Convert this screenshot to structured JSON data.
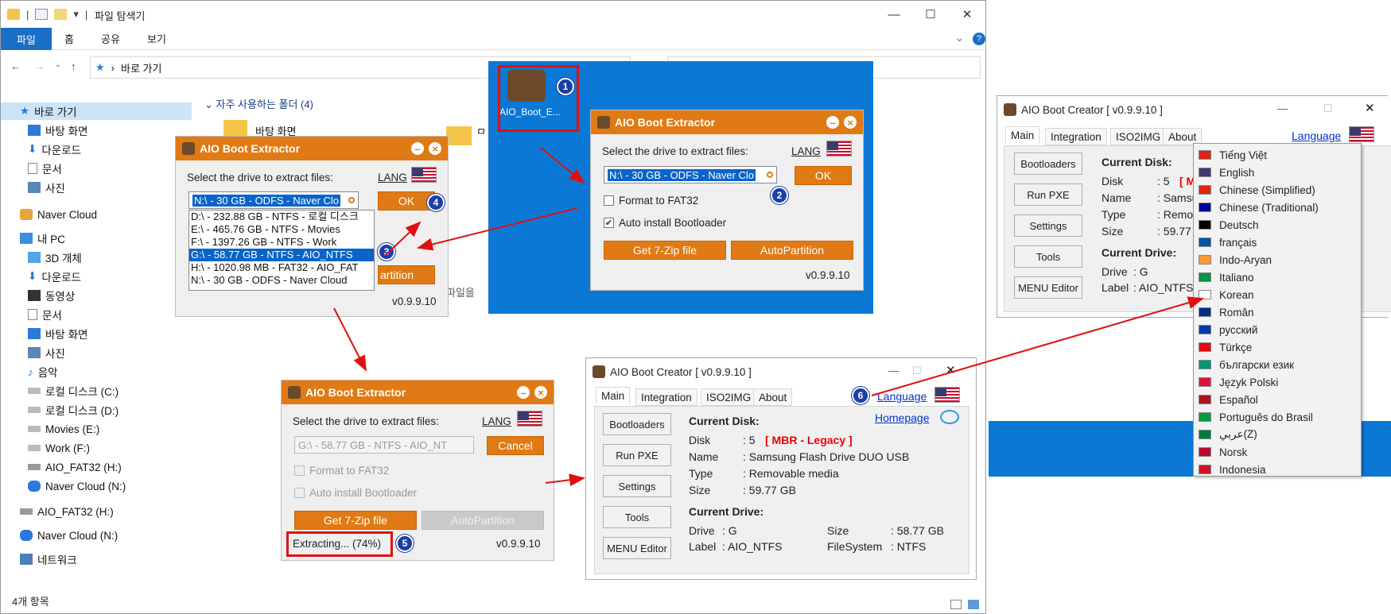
{
  "explorer": {
    "title": "파일 탐색기",
    "ribbon_tabs": [
      "파일",
      "홈",
      "공유",
      "보기"
    ],
    "address": "바로 가기",
    "frequent": "자주 사용하는 폴더 (4)",
    "folder_desktop": "바탕 화면",
    "partial_folder": "ㅁ",
    "partial_text": "파일을 ",
    "status": "4개 항목",
    "nav": [
      "바로 가기",
      "바탕 화면",
      "다운로드",
      "문서",
      "사진",
      "Naver Cloud",
      "내 PC",
      "3D 개체",
      "다운로드",
      "동영상",
      "문서",
      "바탕 화면",
      "사진",
      "음악",
      "로컬 디스크 (C:)",
      "로컬 디스크 (D:)",
      "Movies (E:)",
      "Work (F:)",
      "AIO_FAT32 (H:)",
      "Naver Cloud (N:)",
      "AIO_FAT32 (H:)",
      "Naver Cloud (N:)",
      "네트워크"
    ]
  },
  "desktop_icon": "AIO_Boot_E...",
  "extractor": {
    "title": "AIO Boot Extractor",
    "prompt": "Select the drive to extract files:",
    "lang": "LANG",
    "ok": "OK",
    "cancel": "Cancel",
    "format": "Format to FAT32",
    "auto": "Auto install Bootloader",
    "get7zip": "Get 7-Zip file",
    "autopart": "AutoPartition",
    "autopart_partial": "artition",
    "version": "v0.9.9.10",
    "drive_n": "N:\\ - 30 GB - ODFS - Naver Clo",
    "drive_n_main": "N:\\ - 30 GB - ODFS - Naver Clo",
    "drive_g": "G:\\ - 58.77 GB - NTFS - AIO_NT",
    "extracting": "Extracting... (74%)",
    "drives": [
      "D:\\ - 232.88 GB - NTFS - 로컬 디스크",
      "E:\\ - 465.76 GB - NTFS - Movies",
      "F:\\ - 1397.26 GB - NTFS - Work",
      "G:\\ - 58.77 GB - NTFS - AIO_NTFS",
      "H:\\ - 1020.98 MB - FAT32 - AIO_FAT",
      "N:\\ - 30 GB - ODFS - Naver Cloud"
    ]
  },
  "creator": {
    "title": "AIO Boot Creator [ v0.9.9.10 ]",
    "tabs": [
      "Main",
      "Integration",
      "ISO2IMG",
      "About"
    ],
    "language": "Language",
    "homepage": "Homepage",
    "buttons": [
      "Bootloaders",
      "Run PXE",
      "Settings",
      "Tools",
      "MENU Editor"
    ],
    "current_disk": "Current Disk:",
    "current_drive": "Current Drive:",
    "disk_label": "Disk",
    "disk_val": ": 5",
    "mbr": "[ MBR - Legacy ]",
    "mbr_short": "[ MBI",
    "name_label": "Name",
    "name_val": ": Samsung Flash Drive DUO USB",
    "name_short": ": Samsur",
    "type_label": "Type",
    "type_val": ": Removable media",
    "type_short": ": Remova",
    "size_label": "Size",
    "size_val": ": 59.77 GB",
    "size_short": ": 59.77 G",
    "drive_label": "Drive",
    "drive_val": ": G",
    "label_label": "Label",
    "label_val": ": AIO_NTFS",
    "dsize_label": "Size",
    "dsize_val": ": 58.77 GB",
    "fs_label": "FileSystem",
    "fs_val": ": NTFS"
  },
  "languages": [
    {
      "name": "Tiếng Việt",
      "color": "#da251d"
    },
    {
      "name": "English",
      "color": "#3c3b6e"
    },
    {
      "name": "Chinese (Simplified)",
      "color": "#de2910"
    },
    {
      "name": "Chinese (Traditional)",
      "color": "#000095"
    },
    {
      "name": "Deutsch",
      "color": "#000000"
    },
    {
      "name": "français",
      "color": "#0055a4"
    },
    {
      "name": "Indo-Aryan",
      "color": "#ff9933"
    },
    {
      "name": "Italiano",
      "color": "#009246"
    },
    {
      "name": "Korean",
      "color": "#ffffff"
    },
    {
      "name": "Român",
      "color": "#002b7f"
    },
    {
      "name": "русский",
      "color": "#0039a6"
    },
    {
      "name": "Türkçe",
      "color": "#e30a17"
    },
    {
      "name": "български език",
      "color": "#00966e"
    },
    {
      "name": "Język Polski",
      "color": "#dc143c"
    },
    {
      "name": "Español",
      "color": "#aa151b"
    },
    {
      "name": "Português do Brasil",
      "color": "#009c3b"
    },
    {
      "name": "عربي(Z)",
      "color": "#007a3d"
    },
    {
      "name": "Norsk",
      "color": "#ba0c2f"
    },
    {
      "name": "Indonesia",
      "color": "#ce1126"
    }
  ],
  "badges": [
    "1",
    "2",
    "3",
    "4",
    "5",
    "6"
  ],
  "colors": {
    "accent": "#e07a14",
    "selection": "#0a64c8",
    "badge": "#1b3fa6",
    "arrow": "#e01010"
  }
}
